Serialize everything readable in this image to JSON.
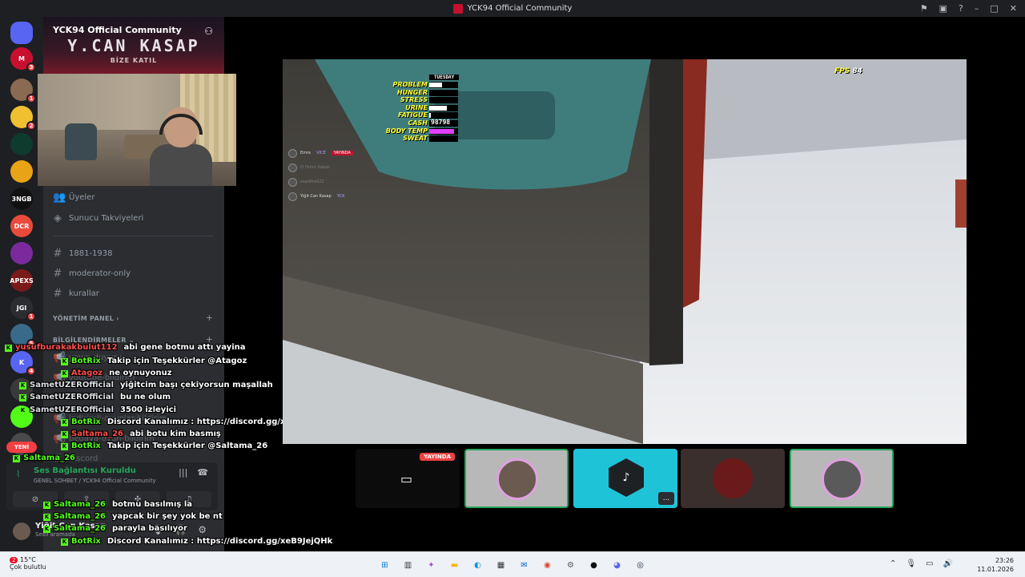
{
  "window": {
    "title": "YCK94 Official Community"
  },
  "servers": [
    {
      "label": "",
      "badge": "",
      "color": "#5865f2"
    },
    {
      "label": "M",
      "badge": "3",
      "color": "#c8102e"
    },
    {
      "label": "",
      "badge": "1",
      "color": "#8a6a52"
    },
    {
      "label": "",
      "badge": "2",
      "color": "#f0c030"
    },
    {
      "label": "",
      "badge": "",
      "color": "#0e3b2e"
    },
    {
      "label": "",
      "badge": "",
      "color": "#e8a317"
    },
    {
      "label": "3NGB",
      "badge": "",
      "color": "#111111"
    },
    {
      "label": "DCR",
      "badge": "",
      "color": "#e84b3c"
    },
    {
      "label": "",
      "badge": "",
      "color": "#7b2a9e"
    },
    {
      "label": "APEXS",
      "badge": "",
      "color": "#7a1a1a"
    },
    {
      "label": "JGI",
      "badge": "1",
      "color": "#2b2d31"
    },
    {
      "label": "",
      "badge": "5",
      "color": "#3a6a8a"
    },
    {
      "label": "K",
      "badge": "4",
      "color": "#5865f2"
    },
    {
      "label": "",
      "badge": "",
      "color": "#3a3a3a"
    },
    {
      "label": "",
      "badge": "",
      "color": "#53fc18"
    },
    {
      "label": "",
      "badge": "",
      "color": "#4a4a4a"
    }
  ],
  "new_pill": "YENİ",
  "sidebar": {
    "server_name": "YCK94 Official Community",
    "banner_title": "Y.CAN KASAP",
    "banner_sub": "BİZE KATIL",
    "items": [
      {
        "label": "Üyeler",
        "icon": "members-icon"
      },
      {
        "label": "Sunucu Takviyeleri",
        "icon": "boost-icon"
      }
    ],
    "channels": [
      "1881-1938",
      "moderator-only",
      "kurallar"
    ],
    "category1": "YÖNETİM PANEL",
    "category2": "BİLGİLENDİRMELER",
    "partial_channels": [
      "yayın-duyuru",
      "youtube-bildirim",
      "indirimli-oyunlar-bildirim",
      "bedava-oyun-bildirim",
      "discord"
    ]
  },
  "voice_panel": {
    "title": "Ses Bağlantısı Kuruldu",
    "subtitle": "GENEL SOHBET / YCK94 Official Community"
  },
  "user": {
    "name": "Yiğit Can Kasap",
    "status": "Sesli aramada"
  },
  "chat": [
    {
      "user": "yusufburakakbulut112",
      "color": "#ff4d4d",
      "msg": "abi gene botmu attı yayina"
    },
    {
      "user": "BotRix",
      "color": "#53fc18",
      "msg": "Takip için Teşekkürler @Atagoz"
    },
    {
      "user": "Atagoz",
      "color": "#ff4d4d",
      "msg": "ne oynuyonuz"
    },
    {
      "user": "SametUZEROfficial",
      "color": "#dbdee1",
      "msg": "yiğitcim başı çekiyorsun maşallah"
    },
    {
      "user": "SametUZEROfficial",
      "color": "#dbdee1",
      "msg": "bu ne olum"
    },
    {
      "user": "SametUZEROfficial",
      "color": "#dbdee1",
      "msg": "3500 izleyici"
    },
    {
      "user": "BotRix",
      "color": "#53fc18",
      "msg": "Discord Kanalımız : https://discord.gg/xeB9JejQHk"
    },
    {
      "user": "Saltama_26",
      "color": "#ff4d4d",
      "msg": "abi botu kim basmış"
    },
    {
      "user": "BotRix",
      "color": "#53fc18",
      "msg": "Takip için Teşekkürler @Saltama_26"
    },
    {
      "user": "Saltama_26",
      "color": "#53fc18",
      "msg": ""
    },
    {
      "user": "Saltama_26",
      "color": "#53fc18",
      "msg": "botmu basılmış la"
    },
    {
      "user": "Saltama_26",
      "color": "#53fc18",
      "msg": "yapcak bir şey yok be nt"
    },
    {
      "user": "Saltama_26",
      "color": "#53fc18",
      "msg": "parayla basılıyor"
    },
    {
      "user": "BotRix",
      "color": "#53fc18",
      "msg": "Discord Kanalımız : https://discord.gg/xeB9JejQHk"
    }
  ],
  "game_hud": {
    "day": "TUESDAY",
    "rows": [
      {
        "label": "PROBLEM",
        "value": "",
        "fill": 0.45,
        "color": "#ffffff"
      },
      {
        "label": "HUNGER",
        "value": "",
        "fill": 0,
        "color": "#ffffff"
      },
      {
        "label": "STRESS",
        "value": "",
        "fill": 0,
        "color": "#ffffff"
      },
      {
        "label": "URINE",
        "value": "",
        "fill": 0.6,
        "color": "#ffffff"
      },
      {
        "label": "FATIGUE",
        "value": "",
        "fill": 0.05,
        "color": "#ffffff"
      },
      {
        "label": "CASH",
        "value": "98798",
        "fill": 0,
        "color": "#ffffff"
      },
      {
        "label": "BODY TEMP",
        "value": "",
        "fill": 0.85,
        "color": "#e040fb"
      },
      {
        "label": "SWEAT",
        "value": "",
        "fill": 0,
        "color": "#ffffff"
      }
    ],
    "fps_label": "FPS",
    "fps_value": "84"
  },
  "game_voice": [
    {
      "name": "Emre",
      "tags": [
        "VICE",
        "YAYINDA"
      ]
    },
    {
      "name": "El Fatiro Kabak",
      "tags": []
    },
    {
      "name": "esadfira022",
      "tags": []
    },
    {
      "name": "Yiğit Can Kasap",
      "tags": [
        "YCK"
      ]
    }
  ],
  "stream_tiles": {
    "live_label": "YAYINDA",
    "more_label": "..."
  },
  "taskbar": {
    "weather_temp": "15°C",
    "weather_desc": "Çok bulutlu",
    "weather_badge": "2",
    "time": "23:26",
    "date": "11.01.2026"
  }
}
